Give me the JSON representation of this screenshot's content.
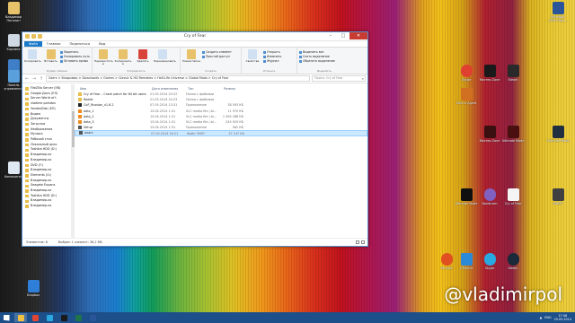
{
  "window": {
    "title": "Cry of Fear",
    "tabs": [
      "Файл",
      "Главная",
      "Поделиться",
      "Вид"
    ],
    "ribbon": {
      "clipboard": {
        "copy": "Копировать",
        "paste": "Вставить",
        "cut": "Вырезать",
        "copy_path": "Копировать путь",
        "paste_shortcut": "Вставить ярлык",
        "group": "Буфер обмена"
      },
      "organize": {
        "move_to": "Переместить в",
        "copy_to": "Копировать в",
        "delete": "Удалить",
        "rename": "Переименовать",
        "group": "Упорядочить"
      },
      "new": {
        "new_folder": "Новая папка",
        "new_item": "Создать элемент",
        "easy_access": "Простой доступ",
        "group": "Создать"
      },
      "open": {
        "properties": "Свойства",
        "open": "Открыть",
        "edit": "Изменить",
        "history": "Журнал",
        "group": "Открыть"
      },
      "select": {
        "select_all": "Выделить все",
        "select_none": "Снять выделение",
        "invert": "Обратить выделение",
        "group": "Выделить"
      }
    },
    "address": "Users  >  Владимир  >  Downloads  >  Games  >  Classic & HD Remakes  >  Half-Life Universe  >  Global Mods  >  Cry of Fear",
    "search_placeholder": "Поиск: Cry of Fear",
    "navpane": [
      "FileZilla Server (EN)",
      "Google Диск (ЕЛ)",
      "Server World of t",
      "vladimir.pahidov",
      "YandexDisk (ЕЛ)",
      "Видео",
      "Документы",
      "Загрузки",
      "Изображения",
      "Музыка",
      "Рабочий стол",
      "Локальный диск",
      "Toshiba HDD (D:)",
      "Владимир-ко",
      "Владимир-ко",
      "DVD (F:)",
      "Владимир-ко",
      "Elements (G:)",
      "Владимир-ко",
      "Seagate Expans",
      "Владимир-ко",
      "Toshiba HDD (D:)",
      "Владимир-ко",
      "Владимир-ко"
    ],
    "columns": {
      "name": "Имя",
      "date": "Дата изменения",
      "type": "Тип",
      "size": "Размер"
    },
    "files": [
      {
        "name": "Cry of Fear – Crash patch for 64 bit users",
        "date": "21.05.2014 20:22",
        "type": "Папка с файлами",
        "size": "",
        "color": "#e8bd4a"
      },
      {
        "name": "Redist",
        "date": "21.05.2014 20:23",
        "type": "Папка с файлами",
        "size": "",
        "color": "#e8bd4a"
      },
      {
        "name": "CoF_Russian_v1.6.2",
        "date": "07.05.2014 13:31",
        "type": "Приложение",
        "size": "38 593 КБ",
        "color": "#222222"
      },
      {
        "name": "data_1",
        "date": "13.04.2014 1:31",
        "type": "VLC media file (.bi...",
        "size": "11 970 КБ",
        "color": "#f08a1c"
      },
      {
        "name": "data_2",
        "date": "13.04.2014 1:31",
        "type": "VLC media file (.bi...",
        "size": "1 565 288 КБ",
        "color": "#f08a1c"
      },
      {
        "name": "data_3",
        "date": "13.04.2014 1:31",
        "type": "VLC media file (.bi...",
        "size": "245 929 КБ",
        "color": "#f08a1c"
      },
      {
        "name": "Setup",
        "date": "13.04.2014 1:31",
        "type": "Приложение",
        "size": "562 КБ",
        "color": "#555555"
      },
      {
        "name": "unarc",
        "date": "07.05.2014 16:21",
        "type": "Файл \"RAR\"",
        "size": "37 147 КБ",
        "color": "#555555"
      }
    ],
    "selected_index": 7,
    "status": {
      "count": "Элементов: 8",
      "selected": "Выбран 1 элемент: 36,2 МБ"
    }
  },
  "desktop": {
    "left_icons": [
      "Владимир Погонин",
      "Корзина",
      "Сеть",
      "Панель управления",
      "Компьютер",
      "Dropbox"
    ],
    "right_icons": [
      "Microsoft Office Wor...",
      "Skype",
      "Мастер Zone",
      "Steam",
      "Mail.ru Agent",
      "Мастер Zone",
      "Ultimate Mode",
      "Ultimate Mode",
      "Ultimate Mode",
      "Bandicam",
      "ABBYY",
      "Cry of Fear",
      "Recycle",
      "uTorrent",
      "Skype",
      "Steam"
    ],
    "watermark": "@vladimirpol"
  },
  "taskbar": {
    "apps": [
      {
        "name": "explorer",
        "color": "#f0c040"
      },
      {
        "name": "chrome",
        "color": "#dd4433"
      },
      {
        "name": "skype",
        "color": "#29a9e0"
      },
      {
        "name": "media",
        "color": "#1a1a1a"
      },
      {
        "name": "excel",
        "color": "#20744a"
      },
      {
        "name": "word",
        "color": "#2a5699"
      }
    ],
    "lang": "ENG",
    "time": "17:56",
    "date": "25.05.2014"
  }
}
